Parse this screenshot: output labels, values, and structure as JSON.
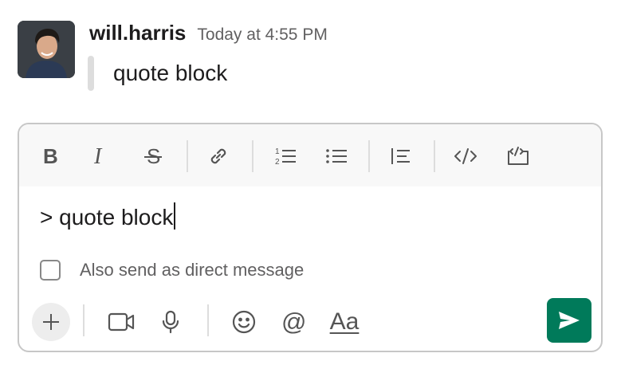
{
  "message": {
    "author": "will.harris",
    "timestamp": "Today at 4:55 PM",
    "quote_text": "quote block"
  },
  "composer": {
    "toolbar": [
      "bold-icon",
      "italic-icon",
      "strikethrough-icon",
      "link-icon",
      "ordered-list-icon",
      "bulleted-list-icon",
      "blockquote-icon",
      "code-icon",
      "code-block-icon"
    ],
    "input_value": "> quote block",
    "dm_label": "Also send as direct message",
    "dm_checked": false,
    "bottom_actions": [
      "plus-icon",
      "video-icon",
      "microphone-icon",
      "emoji-icon",
      "mention-icon",
      "formatting-icon",
      "send-icon"
    ],
    "formatting_label": "Aa"
  },
  "colors": {
    "send_button": "#007a5a",
    "toolbar_bg": "#f8f8f8",
    "quote_bar": "#dddddd",
    "muted_text": "#616061"
  }
}
